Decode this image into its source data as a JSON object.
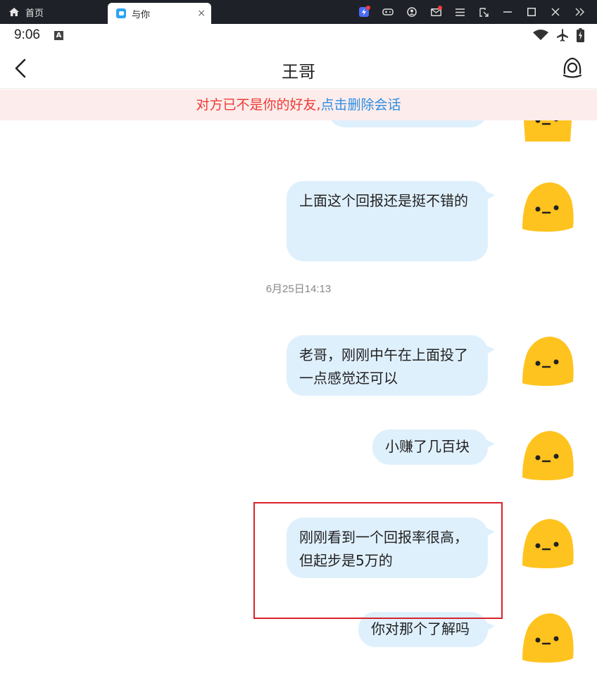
{
  "window": {
    "home_tab_label": "首页",
    "active_tab_label": "与你",
    "tab_close_glyph": "×"
  },
  "status_bar": {
    "time": "9:06",
    "notification_badge": "A"
  },
  "header": {
    "title": "王哥"
  },
  "banner": {
    "warning_text": "对方已不是你的好友,",
    "link_text": "点击删除会话"
  },
  "messages": [
    {
      "text": "上面这个回报还是挺不错的"
    },
    {
      "text": "老哥，刚刚中午在上面投了一点感觉还可以"
    },
    {
      "text": "小赚了几百块"
    },
    {
      "text": "刚刚看到一个回报率很高，但起步是5万的"
    },
    {
      "text": "你对那个了解吗"
    }
  ],
  "timestamps": [
    "6月25日14:13"
  ],
  "colors": {
    "bubble": "#dff0fd",
    "banner_bg": "#fdecec",
    "banner_warning": "#ee3a32",
    "banner_link": "#2d8ee3",
    "highlight": "#d9222a",
    "avatar": "#ffc31f"
  }
}
